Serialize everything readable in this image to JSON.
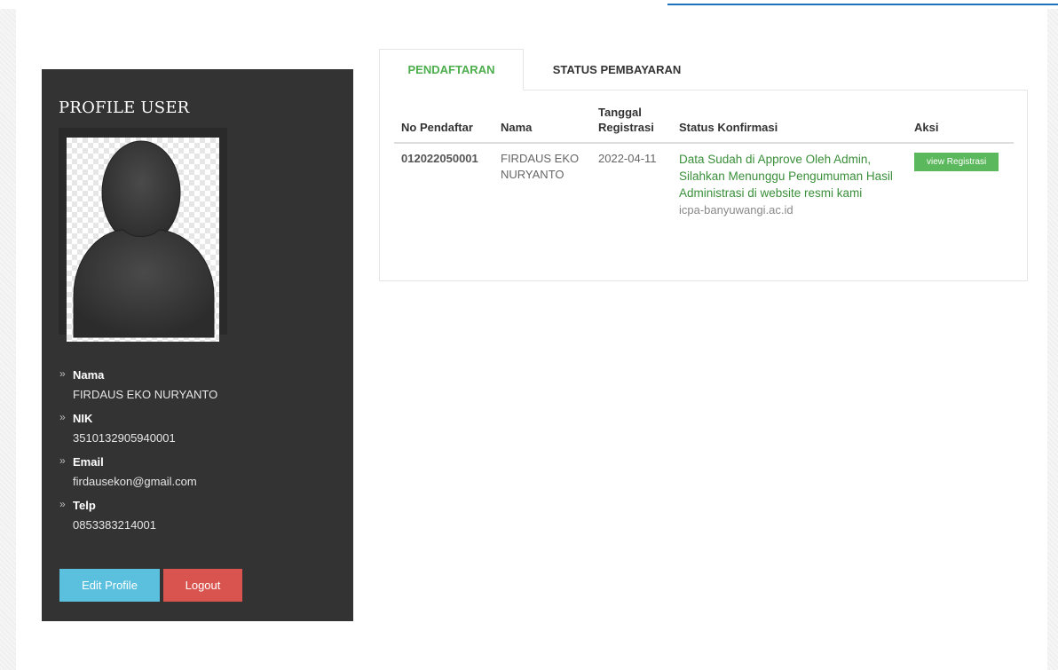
{
  "sidebar": {
    "title": "PROFILE USER",
    "fields": [
      {
        "label": "Nama",
        "value": "FIRDAUS EKO NURYANTO"
      },
      {
        "label": "NIK",
        "value": "3510132905940001"
      },
      {
        "label": "Email",
        "value": "firdausekon@gmail.com"
      },
      {
        "label": "Telp",
        "value": "0853383214001"
      }
    ],
    "edit_label": "Edit Profile",
    "logout_label": "Logout"
  },
  "tabs": {
    "pendaftaran": "PENDAFTARAN",
    "status_pembayaran": "STATUS PEMBAYARAN"
  },
  "table": {
    "headers": [
      "No Pendaftar",
      "Nama",
      "Tanggal Registrasi",
      "Status Konfirmasi",
      "Aksi"
    ],
    "rows": [
      {
        "no": "012022050001",
        "nama": "FIRDAUS EKO NURYANTO",
        "tanggal": "2022-04-11",
        "status": "Data Sudah di Approve Oleh Admin, Silahkan Menunggu Pengumuman Hasil Administrasi di website resmi kami",
        "website": "icpa-banyuwangi.ac.id",
        "aksi": "view Registrasi"
      }
    ]
  },
  "colors": {
    "sidebar_bg": "#333333",
    "tab_active": "#4cae4c",
    "edit_button": "#5bc0de",
    "logout_button": "#d9534f",
    "view_button": "#5cb85c",
    "status_text": "#3a8f3a"
  }
}
